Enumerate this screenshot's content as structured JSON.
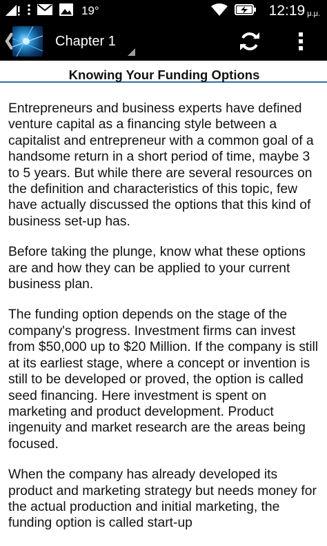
{
  "status_bar": {
    "temperature": "19°",
    "time": "12:19",
    "ampm": "μ.μ."
  },
  "header": {
    "title": "Chapter 1"
  },
  "article": {
    "heading": "Knowing Your Funding Options",
    "paragraphs": [
      "Entrepreneurs and business experts have defined venture capital as a financing style between a capitalist and entrepreneur with a common goal of a handsome return in a short period of time, maybe 3 to 5 years. But while there are several resources on the definition and characteristics of this topic, few have actually discussed the options that this kind of business set-up has.",
      "Before taking the plunge, know what these options are and how they can be applied to your current business plan.",
      "The funding option depends on the stage of the company's progress. Investment firms can invest from $50,000 up to $20 Million. If the company is still at its earliest stage, where a concept or invention is still to be developed or proved, the option is called seed financing. Here investment is spent on marketing and product development. Product ingenuity and market research are the areas being focused.",
      "When the company has already developed its product and marketing strategy but needs money for the actual production and initial marketing, the funding option is called start-up"
    ]
  }
}
